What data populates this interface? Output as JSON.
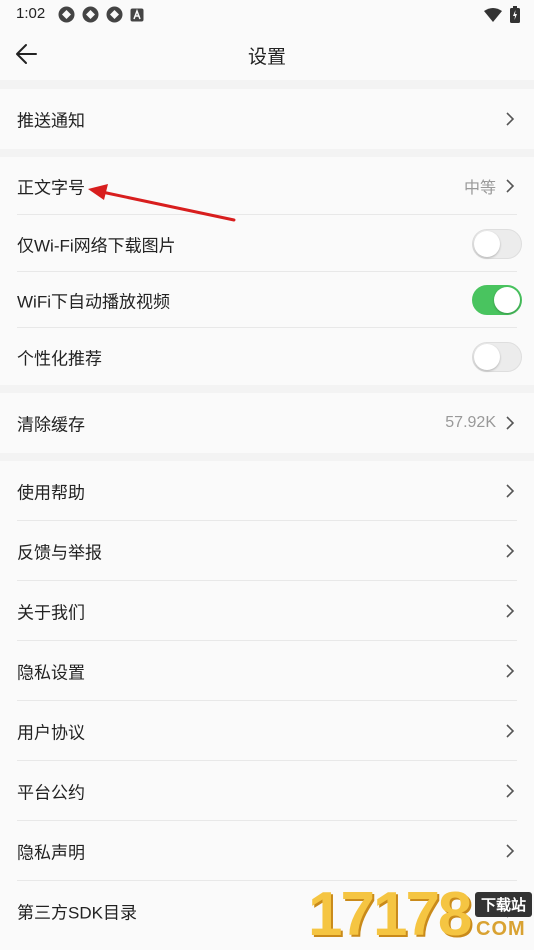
{
  "status": {
    "time": "1:02",
    "icons": [
      "sync-icon",
      "sync-icon",
      "sync-icon",
      "a-box-icon"
    ],
    "right_icons": [
      "wifi-icon",
      "battery-icon"
    ]
  },
  "header": {
    "title": "设置"
  },
  "groups": [
    {
      "items": [
        {
          "label": "推送通知",
          "type": "link"
        }
      ]
    },
    {
      "items": [
        {
          "label": "正文字号",
          "type": "link",
          "value": "中等"
        },
        {
          "label": "仅Wi-Fi网络下载图片",
          "type": "toggle",
          "on": false
        },
        {
          "label": "WiFi下自动播放视频",
          "type": "toggle",
          "on": true
        },
        {
          "label": "个性化推荐",
          "type": "toggle",
          "on": false
        }
      ]
    },
    {
      "items": [
        {
          "label": "清除缓存",
          "type": "link",
          "value": "57.92K"
        }
      ]
    },
    {
      "items": [
        {
          "label": "使用帮助",
          "type": "link"
        },
        {
          "label": "反馈与举报",
          "type": "link"
        },
        {
          "label": "关于我们",
          "type": "link"
        },
        {
          "label": "隐私设置",
          "type": "link"
        },
        {
          "label": "用户协议",
          "type": "link"
        },
        {
          "label": "平台公约",
          "type": "link"
        },
        {
          "label": "隐私声明",
          "type": "link"
        },
        {
          "label": "第三方SDK目录",
          "type": "link"
        }
      ]
    }
  ],
  "watermark": {
    "number": "17178",
    "tag": "下载站",
    "domain": "COM"
  },
  "colors": {
    "toggle_on": "#49c45f",
    "annotation_arrow": "#d81e1e"
  }
}
